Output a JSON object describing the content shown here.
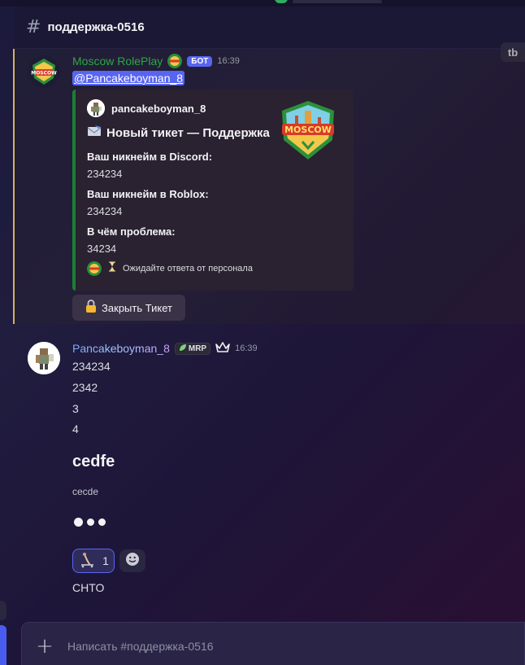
{
  "channel": {
    "name": "поддержка-0516",
    "hash_icon": "hash-icon"
  },
  "corner_button": {
    "label": "tb"
  },
  "bot_message": {
    "author": "Moscow RolePlay",
    "badge": "БОТ",
    "time": "16:39",
    "mention": "@Pancakeboyman_8",
    "embed": {
      "author_name": "pancakeboyman_8",
      "title_icon": "envelope-icon",
      "title": "Новый тикет — Поддержка",
      "fields": [
        {
          "name": "Ваш никнейм в Discord:",
          "value": "234234"
        },
        {
          "name": "Ваш никнейм в Roblox:",
          "value": "234234"
        },
        {
          "name": "В чём проблема:",
          "value": "34234"
        }
      ],
      "footer_icon": "hourglass-icon",
      "footer": "Ожидайте ответа от персонала",
      "accent_color": "#1e7e34"
    },
    "button": {
      "icon": "lock-icon",
      "label": "Закрыть Тикет"
    }
  },
  "user_message": {
    "author": "Pancakeboyman_8",
    "guild_tag": "MRP",
    "time": "16:39",
    "lines": [
      "234234",
      "2342",
      "3",
      "4"
    ],
    "heading": "cedfe",
    "small": "cecde",
    "reaction": {
      "count": "1",
      "emoji": "skater-emoji"
    },
    "last_line": "CHTO"
  },
  "composer": {
    "placeholder": "Написать #поддержка-0516"
  },
  "colors": {
    "accent": "#5865f2",
    "bot_name": "#2aa845",
    "highlight_border": "#d4b164"
  }
}
